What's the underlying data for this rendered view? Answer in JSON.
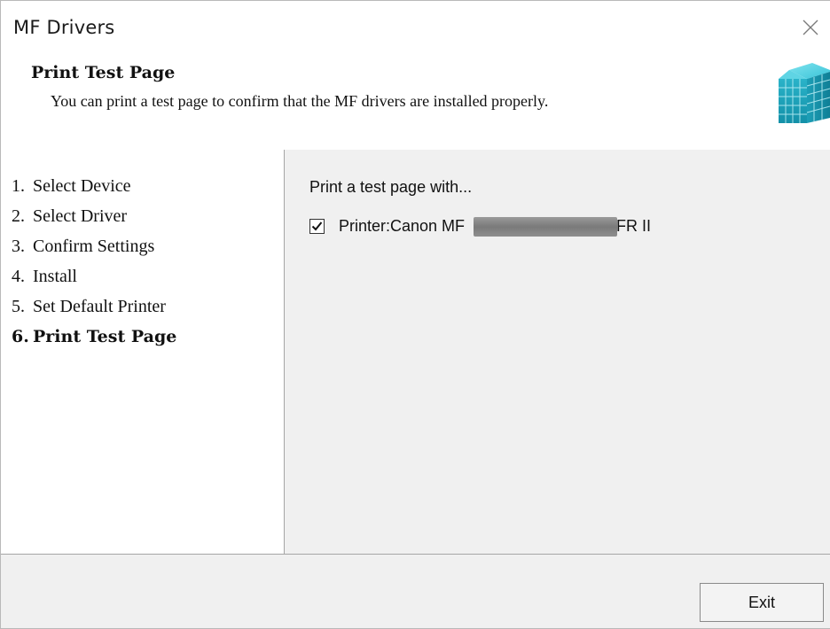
{
  "window": {
    "title": "MF Drivers",
    "close_icon": "close-icon"
  },
  "header": {
    "title": "Print Test Page",
    "description": "You can print a test page to confirm that the MF drivers are installed properly.",
    "logo_icon": "canon-installer-cube-icon"
  },
  "steps": [
    {
      "num": "1.",
      "label": "Select Device"
    },
    {
      "num": "2.",
      "label": "Select Driver"
    },
    {
      "num": "3.",
      "label": "Confirm Settings"
    },
    {
      "num": "4.",
      "label": "Install"
    },
    {
      "num": "5.",
      "label": "Set Default Printer"
    },
    {
      "num": "6.",
      "label": "Print Test Page"
    }
  ],
  "current_step_index": 5,
  "content": {
    "heading": "Print a test page with...",
    "printer_option": {
      "checked": true,
      "label_prefix": "Printer:Canon MF",
      "label_suffix": "UFR II"
    }
  },
  "footer": {
    "exit_label": "Exit"
  },
  "colors": {
    "panel_background": "#f0f0f0",
    "divider": "#a5a5a5",
    "logo_teal": "#2ab3c9"
  }
}
